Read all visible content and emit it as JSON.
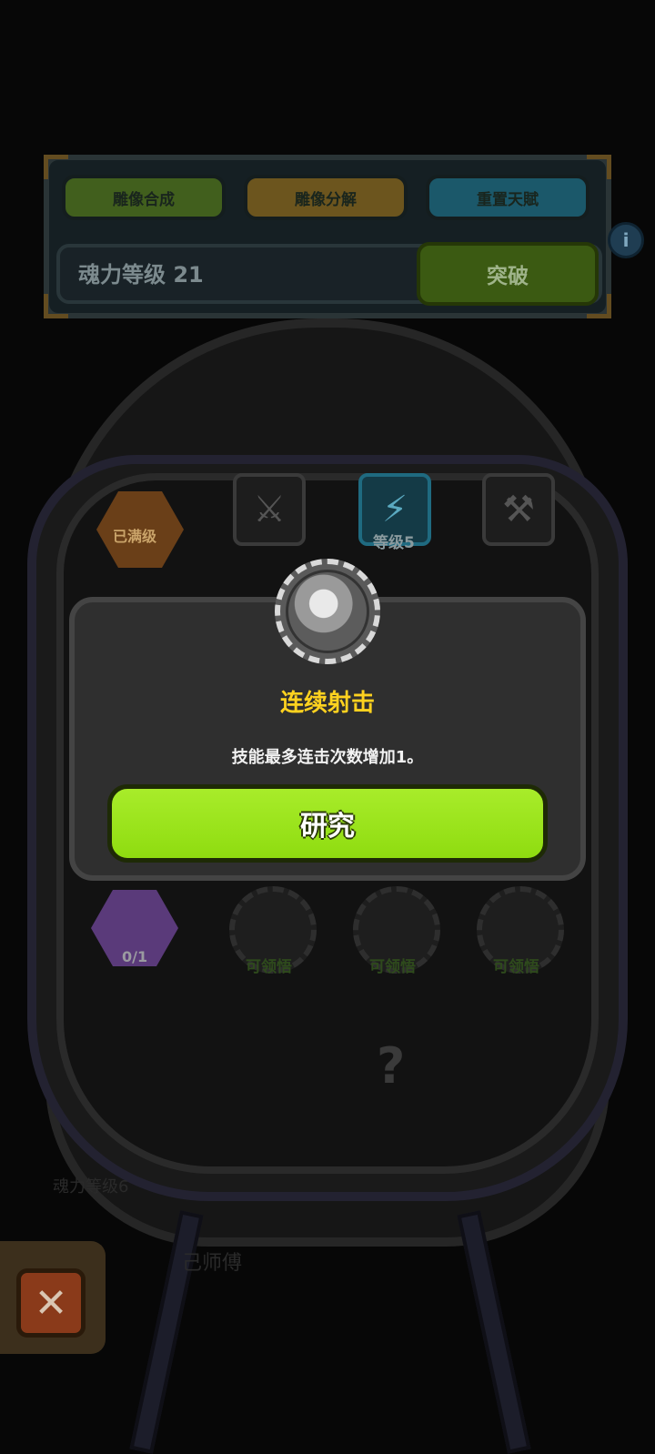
{
  "top_panel": {
    "buttons": [
      {
        "label": "雕像合成",
        "color": "#5f8a1a"
      },
      {
        "label": "雕像分解",
        "color": "#a6791b"
      },
      {
        "label": "重置天賦",
        "color": "#1f7f9a"
      }
    ],
    "level_text": "魂力等级 21",
    "break_label": "突破",
    "info_icon": "i"
  },
  "skill_tree": {
    "maxed_label": "已满级",
    "level_label": "等级5",
    "progress": "0/1",
    "claimable_labels": [
      "可领悟",
      "可领悟",
      "可领悟"
    ],
    "mystery_icon": "?"
  },
  "dialog": {
    "skill_name": "连续射击",
    "skill_description": "技能最多连击次数增加1。",
    "research_label": "研究"
  },
  "background_text": {
    "soul_level": "魂力等级6",
    "master": "己师傅"
  },
  "close_icon": "✕"
}
